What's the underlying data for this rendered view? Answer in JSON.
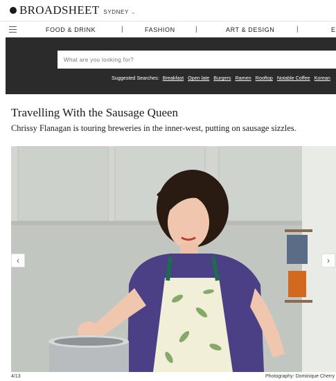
{
  "brand": {
    "logo": "BROADSHEET",
    "city": "SYDNEY",
    "city_caret": "⌄"
  },
  "nav": {
    "items": [
      "FOOD & DRINK",
      "FASHION",
      "ART & DESIGN",
      "EN"
    ],
    "separator": "|"
  },
  "search": {
    "placeholder": "What are you looking for?",
    "suggested_label": "Suggested Searches:",
    "suggestions": [
      "Breakfast",
      "Open late",
      "Burgers",
      "Ramen",
      "Rooftop",
      "Notable Coffee",
      "Korean"
    ]
  },
  "article": {
    "title": "Travelling With the Sausage Queen",
    "standfirst": "Chrissy Flanagan is touring breweries in the inner-west, putting on sausage sizzles."
  },
  "gallery": {
    "prev_icon": "‹",
    "next_icon": "›",
    "counter": "4/13",
    "credit": "Photography: Dominique Cherry"
  },
  "colors": {
    "search_band": "#2b2b2b",
    "text": "#1a1a1a"
  }
}
